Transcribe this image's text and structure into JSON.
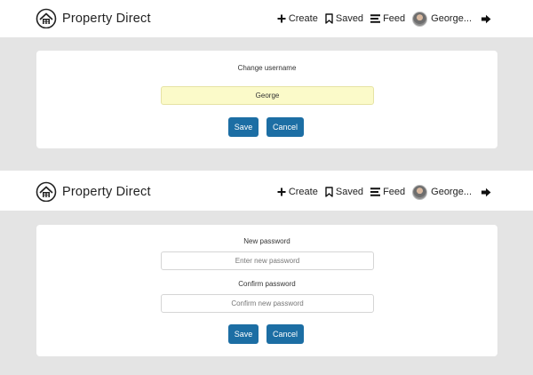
{
  "app": {
    "brand": "Property Direct",
    "nav": {
      "create": "Create",
      "saved": "Saved",
      "feed": "Feed",
      "user": "George..."
    }
  },
  "username_form": {
    "label": "Change username",
    "value": "George",
    "save_label": "Save",
    "cancel_label": "Cancel"
  },
  "password_form": {
    "new_label": "New password",
    "new_placeholder": "Enter new password",
    "confirm_label": "Confirm password",
    "confirm_placeholder": "Confirm new password",
    "save_label": "Save",
    "cancel_label": "Cancel"
  },
  "colors": {
    "primary_button": "#1c6ea4",
    "filled_field": "#fbfac9",
    "page_band": "#e4e4e4"
  }
}
